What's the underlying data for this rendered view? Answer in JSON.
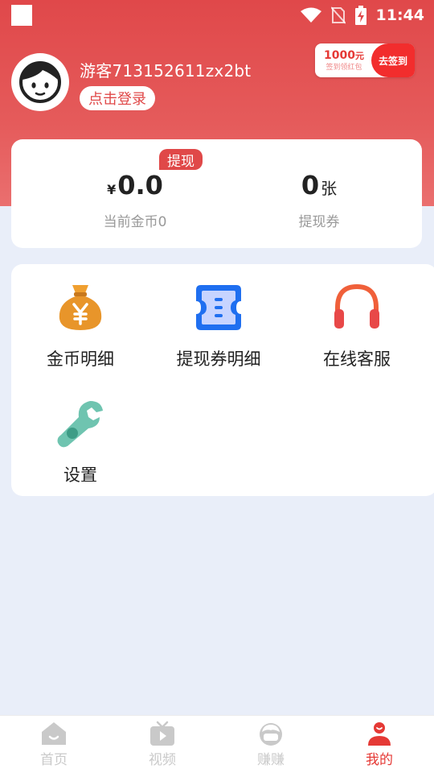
{
  "status_bar": {
    "time": "11:44"
  },
  "profile": {
    "username": "游客713152611zx2bt",
    "login_label": "点击登录"
  },
  "signin_badge": {
    "amount": "1000",
    "amount_unit": "元",
    "subtitle": "签到领红包",
    "action_label": "去签到"
  },
  "balance": {
    "withdraw_tag": "提现",
    "coins": {
      "currency": "¥",
      "value": "0.0",
      "label": "当前金币0"
    },
    "vouchers": {
      "value": "0",
      "unit": "张",
      "label": "提现券"
    }
  },
  "menu": {
    "items": [
      {
        "label": "金币明细",
        "icon": "money-bag-icon"
      },
      {
        "label": "提现券明细",
        "icon": "voucher-icon"
      },
      {
        "label": "在线客服",
        "icon": "headphones-icon"
      },
      {
        "label": "设置",
        "icon": "wrench-icon"
      }
    ]
  },
  "bottom_nav": {
    "items": [
      {
        "label": "首页",
        "icon": "home-icon"
      },
      {
        "label": "视频",
        "icon": "tv-icon"
      },
      {
        "label": "赚赚",
        "icon": "face-icon"
      },
      {
        "label": "我的",
        "icon": "person-icon"
      }
    ],
    "active_index": 3
  },
  "colors": {
    "brand_red": "#e04848",
    "page_bg": "#e9eef9",
    "inactive_nav": "#c9c9c9"
  }
}
